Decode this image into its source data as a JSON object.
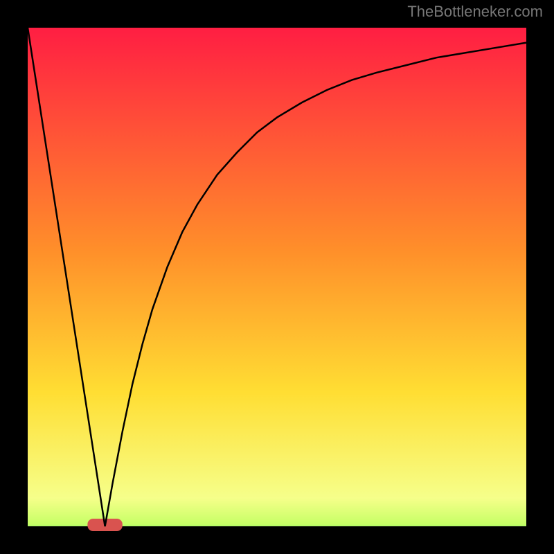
{
  "watermark": "TheBottleneker.com",
  "chart_data": {
    "type": "line",
    "title": "",
    "xlabel": "",
    "ylabel": "",
    "xlim": [
      0,
      1
    ],
    "ylim": [
      0,
      1
    ],
    "background_gradient_colors": {
      "top": "#ff1744",
      "mid_upper": "#ff8f2a",
      "mid_lower": "#ffde33",
      "low_green": "#c6ff66",
      "bottom": "#00e676"
    },
    "frame_color": "#000000",
    "curve_color": "#000000",
    "bottom_marker": {
      "x_center": 0.155,
      "half_width": 0.035,
      "color": "#d9534f"
    },
    "x": [
      0.0,
      0.02,
      0.04,
      0.06,
      0.08,
      0.1,
      0.12,
      0.14,
      0.155,
      0.17,
      0.19,
      0.21,
      0.23,
      0.25,
      0.28,
      0.31,
      0.34,
      0.38,
      0.42,
      0.46,
      0.5,
      0.55,
      0.6,
      0.65,
      0.7,
      0.76,
      0.82,
      0.88,
      0.94,
      1.0
    ],
    "comment": "Piecewise curve: from x=0 the line descends linearly from y=1 to y=0 at x≈0.155, then rises along a saturating curve toward y≈0.97 at x=1.",
    "series": [
      {
        "name": "left-line",
        "x": [
          0.0,
          0.155
        ],
        "y": [
          1.0,
          0.0
        ]
      },
      {
        "name": "right-curve",
        "x": [
          0.155,
          0.17,
          0.19,
          0.21,
          0.23,
          0.25,
          0.28,
          0.31,
          0.34,
          0.38,
          0.42,
          0.46,
          0.5,
          0.55,
          0.6,
          0.65,
          0.7,
          0.76,
          0.82,
          0.88,
          0.94,
          1.0
        ],
        "y": [
          0.0,
          0.085,
          0.19,
          0.285,
          0.365,
          0.435,
          0.52,
          0.59,
          0.645,
          0.705,
          0.75,
          0.79,
          0.82,
          0.85,
          0.875,
          0.895,
          0.91,
          0.925,
          0.94,
          0.95,
          0.96,
          0.97
        ]
      }
    ]
  }
}
